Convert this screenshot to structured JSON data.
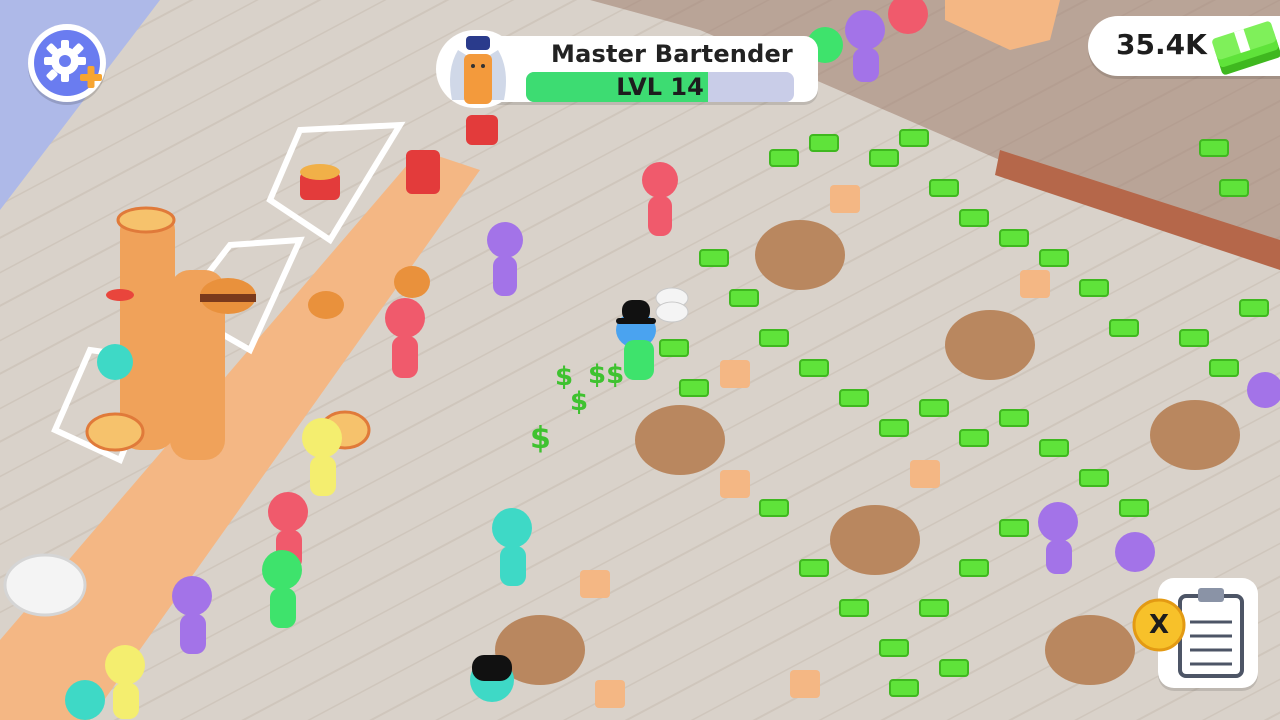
{
  "hud": {
    "settings_icon": "gear-plus-icon",
    "level": {
      "title": "Master Bartender",
      "level_label": "LVL 14",
      "progress": 0.68
    },
    "money": {
      "amount": "35.4K",
      "icon": "cash-stack-icon"
    },
    "order": {
      "icon": "clipboard-icon",
      "badge_label": "X"
    }
  },
  "colors": {
    "floor": "#d9d2ca",
    "counter": "#f4b784",
    "table": "#b9875f",
    "cash": "#5fe33a",
    "progress_fill": "#3ddc72",
    "progress_track": "#c9cde8",
    "accent_blue": "#6a7cf0",
    "accent_orange": "#f7a531"
  }
}
